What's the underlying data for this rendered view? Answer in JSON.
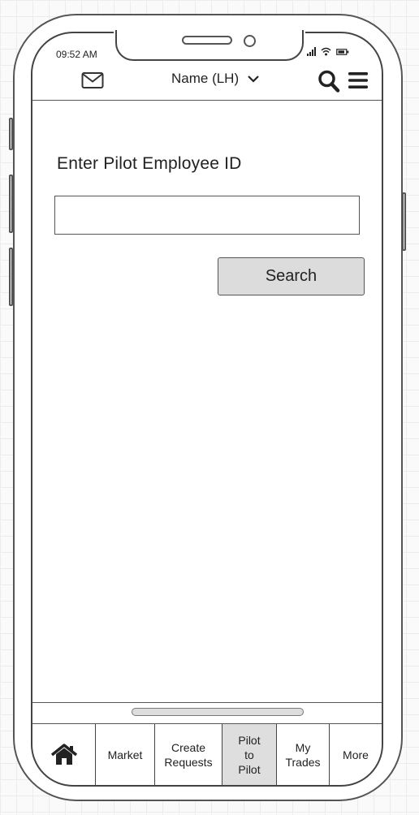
{
  "status_bar": {
    "time": "09:52 AM"
  },
  "header": {
    "mail_icon": "envelope-icon",
    "user_name": "Name (LH)",
    "dropdown_icon": "chevron-down-icon",
    "search_icon": "search-icon",
    "menu_icon": "hamburger-menu-icon"
  },
  "form": {
    "label": "Enter Pilot Employee ID",
    "input_value": "",
    "search_label": "Search"
  },
  "tabbar": {
    "home_icon": "home-icon",
    "tabs": [
      {
        "label": "Market"
      },
      {
        "label": "Create\nRequests"
      },
      {
        "label": "Pilot\nto\nPilot",
        "active": true
      },
      {
        "label": "My\nTrades"
      },
      {
        "label": "More"
      }
    ]
  }
}
